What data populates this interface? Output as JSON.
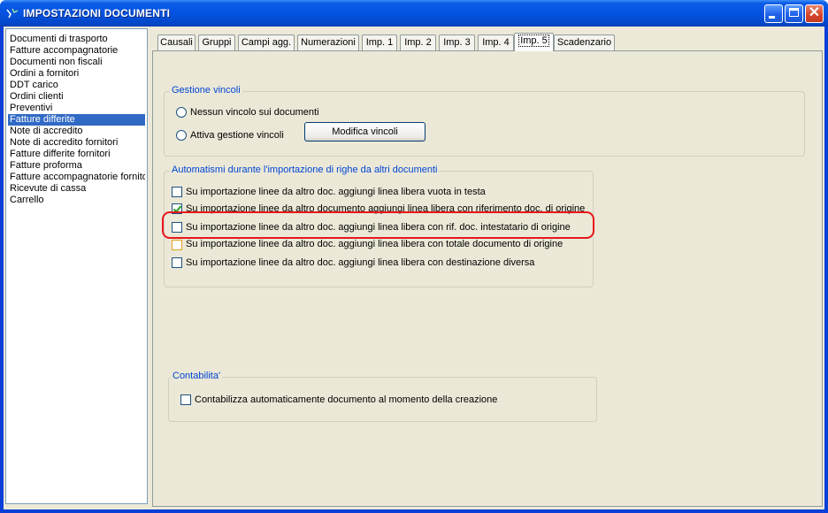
{
  "window": {
    "title": "IMPOSTAZIONI DOCUMENTI"
  },
  "sidebar": {
    "items": [
      "Documenti di trasporto",
      "Fatture accompagnatorie",
      "Documenti non fiscali",
      "Ordini a fornitori",
      "DDT carico",
      "Ordini clienti",
      "Preventivi",
      "Fatture differite",
      "Note di accredito",
      "Note di accredito fornitori",
      "Fatture differite fornitori",
      "Fatture proforma",
      "Fatture accompagnatorie fornitori",
      "Ricevute di cassa",
      "Carrello"
    ],
    "selected": "Fatture differite"
  },
  "tabs": [
    "Causali",
    "Gruppi",
    "Campi agg.",
    "Numerazioni",
    "Imp. 1",
    "Imp. 2",
    "Imp. 3",
    "Imp. 4",
    "Imp. 5",
    "Scadenzario"
  ],
  "active_tab": "Imp. 5",
  "gestione_vincoli": {
    "title": "Gestione vincoli",
    "option_none": "Nessun vincolo sui documenti",
    "option_active": "Attiva gestione vincoli",
    "modify_button": "Modifica vincoli"
  },
  "automatismi": {
    "title": "Automatismi durante l'importazione di righe da altri documenti",
    "options": [
      {
        "label": "Su importazione linee da altro doc. aggiungi linea libera vuota in testa",
        "checked": false
      },
      {
        "label": "Su importazione linee da altro documento aggiungi linea libera con riferimento doc. di origine",
        "checked": true
      },
      {
        "label": "Su importazione linee da altro doc. aggiungi linea libera con rif. doc. intestatario di origine",
        "checked": false,
        "highlighted": true
      },
      {
        "label": "Su importazione linee da altro doc. aggiungi linea libera con totale documento di origine",
        "checked": false
      },
      {
        "label": "Su importazione linee da altro doc. aggiungi linea libera con destinazione diversa",
        "checked": false
      }
    ]
  },
  "contabilita": {
    "title": "Contabilita'",
    "option": "Contabilizza automaticamente documento al momento della creazione",
    "checked": false
  },
  "colors": {
    "titlebar": "#0553e1",
    "selection": "#316ac5",
    "highlight_box": "#e8161b",
    "group_title": "#0046d5"
  }
}
